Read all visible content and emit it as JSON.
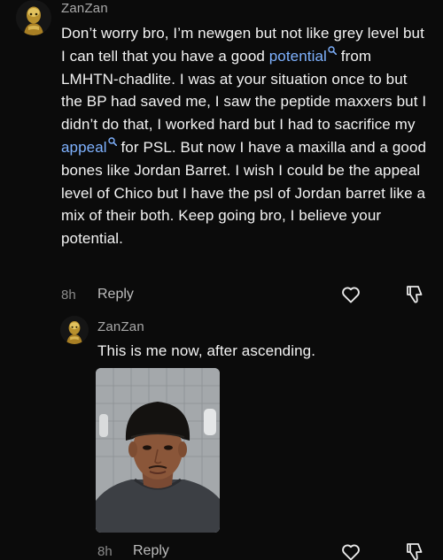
{
  "comment": {
    "username": "ZanZan",
    "text_before_potential": "Don’t worry bro, I’m newgen but not like grey level but I can tell that you have a good ",
    "link_potential": "potential",
    "text_middle": " from LMHTN-chadlite. I was at your situation once to but the BP had saved me, I saw the peptide maxxers but I didn’t do that, I worked hard but I had to sacrifice my ",
    "link_appeal": "appeal",
    "text_after": " for PSL. But now I have a maxilla and a good bones like Jordan Barret. I wish I could be the appeal level of Chico but I have the psl of Jordan barret like a mix of their both. Keep going bro, I believe your potential.",
    "time": "8h",
    "reply_label": "Reply"
  },
  "reply": {
    "username": "ZanZan",
    "text": "This is me now, after ascending.",
    "time": "8h",
    "reply_label": "Reply"
  },
  "icons": {
    "like": "heart-outline-icon",
    "dislike": "thumbs-down-outline-icon",
    "search": "magnifier-icon"
  },
  "colors": {
    "background": "#0b0b0b",
    "link": "#7fb2ff",
    "muted": "#a9a9a9"
  }
}
